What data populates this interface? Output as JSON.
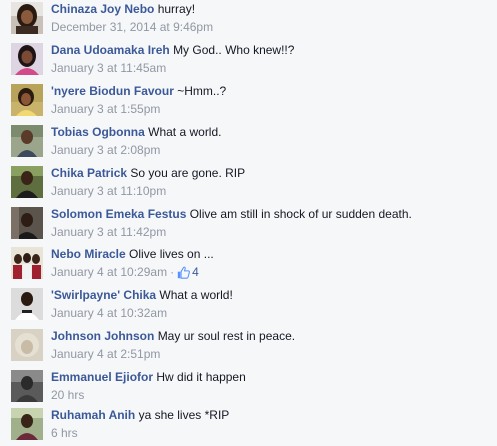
{
  "comments": [
    {
      "author": "Chinaza Joy Nebo",
      "text": "hurray!",
      "time": "December 31, 2014 at 9:46pm",
      "avatar": "woman-dark-hair-photo",
      "likes": null
    },
    {
      "author": "Dana Udoamaka Ireh",
      "text": "My God.. Who knew!!?",
      "time": "January 3 at 11:45am",
      "avatar": "woman-pink-top-photo",
      "likes": null
    },
    {
      "author": "'nyere Biodun Favour",
      "text": "~Hmm..?",
      "time": "January 3 at 1:55pm",
      "avatar": "woman-smiling-photo",
      "likes": null
    },
    {
      "author": "Tobias Ogbonna",
      "text": "What a world.",
      "time": "January 3 at 2:08pm",
      "avatar": "man-portrait-photo",
      "likes": null
    },
    {
      "author": "Chika Patrick",
      "text": "So you are gone. RIP",
      "time": "January 3 at 11:10pm",
      "avatar": "man-outdoor-photo",
      "likes": null
    },
    {
      "author": "Solomon Emeka Festus",
      "text": "Olive am still in shock of ur sudden death.",
      "time": "January 3 at 11:42pm",
      "avatar": "man-dark-photo",
      "likes": null
    },
    {
      "author": "Nebo Miracle",
      "text": "Olive lives on ...",
      "time": "January 4 at 10:29am",
      "avatar": "group-photo",
      "likes": "4"
    },
    {
      "author": "'Swirlpayne' Chika",
      "text": "What a world!",
      "time": "January 4 at 10:32am",
      "avatar": "man-white-shirt-photo",
      "likes": null
    },
    {
      "author": "Johnson Johnson",
      "text": "May ur soul rest in peace.",
      "time": "January 4 at 2:51pm",
      "avatar": "blurred-photo",
      "likes": null
    },
    {
      "author": "Emmanuel Ejiofor",
      "text": "Hw did it happen",
      "time": "20 hrs",
      "avatar": "man-dim-photo",
      "likes": null
    },
    {
      "author": "Ruhamah Anih",
      "text": "ya she lives *RIP",
      "time": "6 hrs",
      "avatar": "woman-outdoor-photo",
      "likes": null
    }
  ],
  "ui": {
    "dot": "·",
    "like_icon": "thumbs-up-icon"
  },
  "colors": {
    "background": "#f6f7f9",
    "author": "#3b5998",
    "text": "#141823",
    "meta": "#9197a3"
  }
}
